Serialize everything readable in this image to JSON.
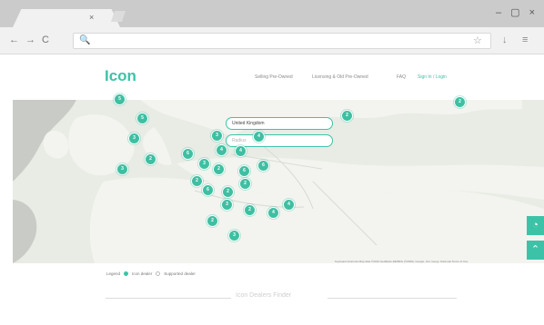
{
  "browser": {
    "tab_close": "×",
    "window_controls": [
      "–",
      "▢",
      "×"
    ],
    "nav_icons": [
      "←",
      "→",
      "C"
    ],
    "omnibox_icon": "search-icon",
    "omnibox_glyph": "🔍",
    "star_glyph": "☆",
    "ext_glyphs": [
      "↓",
      "≡"
    ]
  },
  "site": {
    "logo": "Icon",
    "nav": [
      "Selling Pre-Owned",
      "Licensing & Old Pre-Owned",
      "FAQ",
      "Sign In / Login"
    ]
  },
  "map": {
    "search_value": "United Kingdom",
    "radius_placeholder": "Radius",
    "markers": [
      {
        "label": "5"
      },
      {
        "label": "5"
      },
      {
        "label": "3"
      },
      {
        "label": "3"
      },
      {
        "label": "2"
      },
      {
        "label": "6"
      },
      {
        "label": "3"
      },
      {
        "label": "4"
      },
      {
        "label": "3"
      },
      {
        "label": "2"
      },
      {
        "label": "2"
      },
      {
        "label": "4"
      },
      {
        "label": "6"
      },
      {
        "label": "6"
      },
      {
        "label": "4"
      },
      {
        "label": "6"
      },
      {
        "label": "2"
      },
      {
        "label": "2"
      },
      {
        "label": "3"
      },
      {
        "label": "2"
      },
      {
        "label": "4"
      },
      {
        "label": "4"
      },
      {
        "label": "2"
      },
      {
        "label": "3"
      },
      {
        "label": "2"
      },
      {
        "label": "2"
      }
    ],
    "side_buttons": [
      "◔",
      "⌃"
    ],
    "attribution": "Keyboard shortcuts   Map data ©2016 GeoBasis-DE/BKG (©2009), Google, Inst. Geogr. Nacional   Terms of Use"
  },
  "legend": {
    "label": "Legend",
    "items": [
      {
        "text": "Icon dealer",
        "color": "#3cc3a7"
      },
      {
        "text": "Supported dealer",
        "color": "#ffffff"
      }
    ]
  },
  "section": {
    "title": "Icon Dealers Finder"
  },
  "colors": {
    "accent": "#3cc3a7"
  }
}
